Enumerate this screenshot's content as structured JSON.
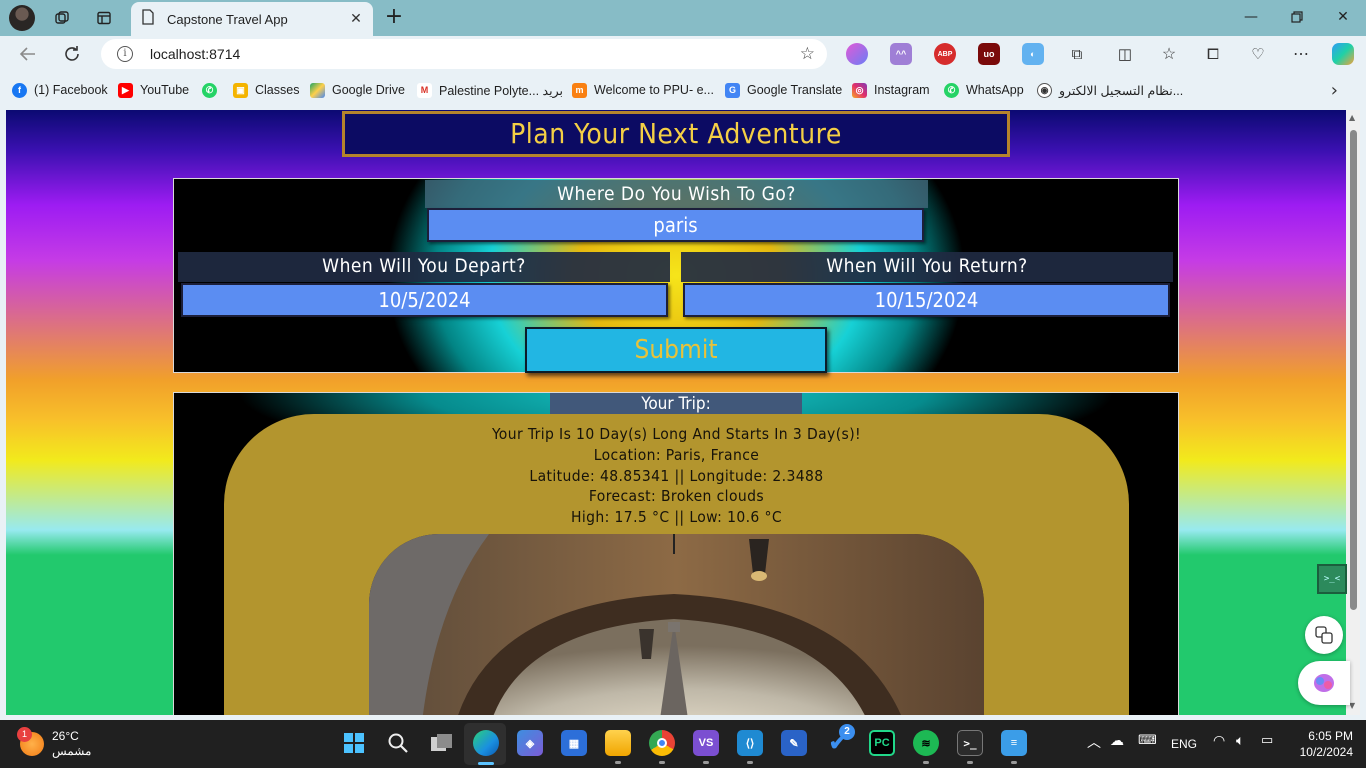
{
  "browser": {
    "tab_title": "Capstone Travel App",
    "address": "localhost:8714",
    "bookmarks": [
      {
        "label": "(1) Facebook",
        "icon": "facebook-icon"
      },
      {
        "label": "YouTube",
        "icon": "youtube-icon"
      },
      {
        "label": "",
        "icon": "whatsapp-icon"
      },
      {
        "label": "Classes",
        "icon": "classroom-icon"
      },
      {
        "label": "Google Drive",
        "icon": "google-drive-icon"
      },
      {
        "label": "Palestine Polyte... بريد",
        "icon": "gmail-icon"
      },
      {
        "label": "Welcome to PPU- e...",
        "icon": "moodle-icon"
      },
      {
        "label": "Google Translate",
        "icon": "translate-icon"
      },
      {
        "label": "Instagram",
        "icon": "instagram-icon"
      },
      {
        "label": "WhatsApp",
        "icon": "whatsapp-icon"
      },
      {
        "label": "نظام التسجيل الالكترو...",
        "icon": "registration-icon"
      }
    ]
  },
  "app": {
    "title": "Plan Your Next Adventure",
    "destination_label": "Where Do You Wish To Go?",
    "destination_value": "paris",
    "depart_label": "When Will You Depart?",
    "depart_value": "10/5/2024",
    "return_label": "When Will You Return?",
    "return_value": "10/15/2024",
    "submit_label": "Submit",
    "trip_heading": "Your Trip:",
    "trip_lines": [
      "Your Trip Is 10 Day(s) Long And Starts In 3 Day(s)!",
      "Location: Paris, France",
      "Latitude: 48.85341 || Longitude: 2.3488",
      "Forecast: Broken clouds",
      "High: 17.5 °C || Low: 10.6 °C"
    ]
  },
  "taskbar": {
    "temperature": "26°C",
    "weather_condition": "مشمس",
    "weather_badge": "1",
    "todo_badge": "2",
    "language": "ENG",
    "time": "6:05 PM",
    "date": "10/2/2024"
  },
  "colors": {
    "title_text": "#f4cf45",
    "input_bg": "#5b8df2",
    "submit_bg": "#22b6e3",
    "trip_panel": "#b3952e"
  }
}
